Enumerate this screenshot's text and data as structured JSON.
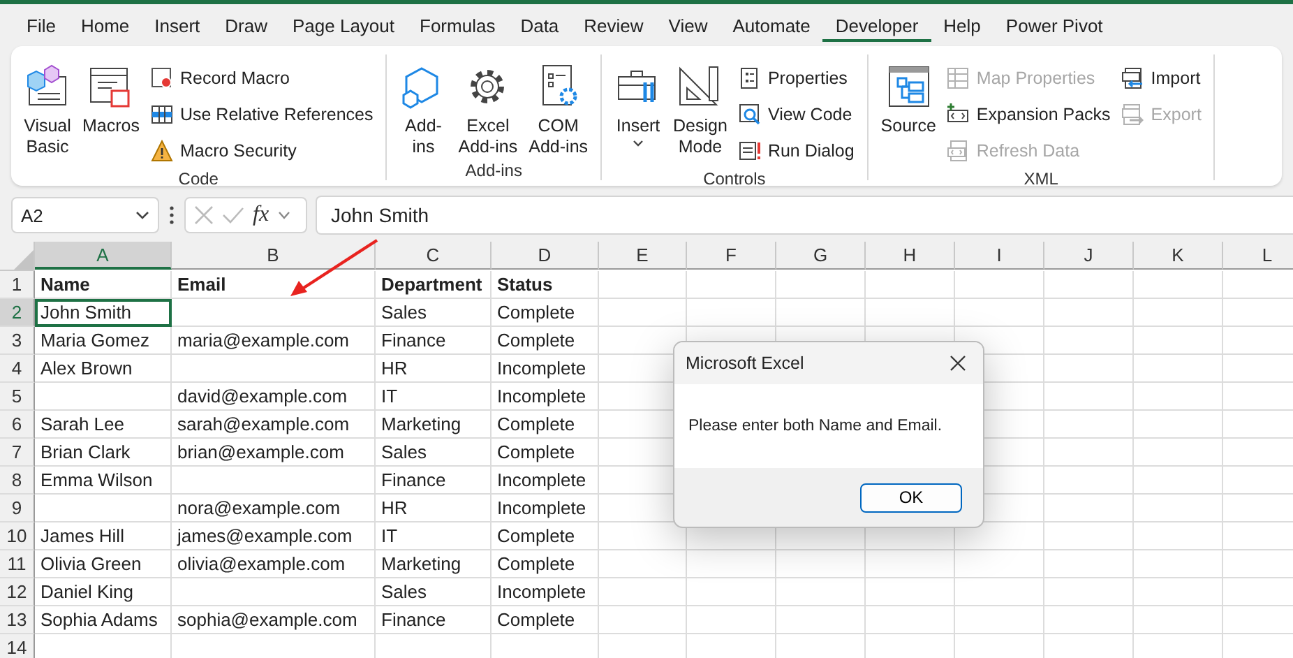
{
  "menu_tabs": [
    {
      "label": "File",
      "selected": false
    },
    {
      "label": "Home",
      "selected": false
    },
    {
      "label": "Insert",
      "selected": false
    },
    {
      "label": "Draw",
      "selected": false
    },
    {
      "label": "Page Layout",
      "selected": false
    },
    {
      "label": "Formulas",
      "selected": false
    },
    {
      "label": "Data",
      "selected": false
    },
    {
      "label": "Review",
      "selected": false
    },
    {
      "label": "View",
      "selected": false
    },
    {
      "label": "Automate",
      "selected": false
    },
    {
      "label": "Developer",
      "selected": true
    },
    {
      "label": "Help",
      "selected": false
    },
    {
      "label": "Power Pivot",
      "selected": false
    }
  ],
  "ribbon": {
    "groups": [
      {
        "label": "Code",
        "items": [
          {
            "kind": "large",
            "lines": [
              "Visual",
              "Basic"
            ]
          },
          {
            "kind": "large",
            "lines": [
              "Macros"
            ]
          },
          {
            "kind": "column",
            "items": [
              {
                "label": "Record Macro",
                "disabled": false
              },
              {
                "label": "Use Relative References",
                "disabled": false
              },
              {
                "label": "Macro Security",
                "disabled": false
              }
            ]
          }
        ]
      },
      {
        "label": "Add-ins",
        "items": [
          {
            "kind": "large",
            "lines": [
              "Add-",
              "ins"
            ]
          },
          {
            "kind": "large",
            "lines": [
              "Excel",
              "Add-ins"
            ]
          },
          {
            "kind": "large",
            "lines": [
              "COM",
              "Add-ins"
            ]
          }
        ]
      },
      {
        "label": "Controls",
        "items": [
          {
            "kind": "large",
            "lines": [
              "Insert"
            ],
            "has_menu": true
          },
          {
            "kind": "large",
            "lines": [
              "Design",
              "Mode"
            ]
          },
          {
            "kind": "column",
            "items": [
              {
                "label": "Properties",
                "disabled": false
              },
              {
                "label": "View Code",
                "disabled": false
              },
              {
                "label": "Run Dialog",
                "disabled": false
              }
            ]
          }
        ]
      },
      {
        "label": "XML",
        "items": [
          {
            "kind": "large",
            "lines": [
              "Source"
            ]
          },
          {
            "kind": "column",
            "items": [
              {
                "label": "Map Properties",
                "disabled": true
              },
              {
                "label": "Expansion Packs",
                "disabled": false
              },
              {
                "label": "Refresh Data",
                "disabled": true
              }
            ]
          },
          {
            "kind": "column",
            "items": [
              {
                "label": "Import",
                "disabled": false
              },
              {
                "label": "Export",
                "disabled": true
              }
            ]
          }
        ]
      }
    ]
  },
  "formula_bar": {
    "name_box": "A2",
    "function_label": "fx",
    "value": "John Smith"
  },
  "sheet": {
    "columns": [
      {
        "label": "A",
        "selected": true
      },
      {
        "label": "B",
        "selected": false
      },
      {
        "label": "C",
        "selected": false
      },
      {
        "label": "D",
        "selected": false
      },
      {
        "label": "E",
        "selected": false
      },
      {
        "label": "F",
        "selected": false
      },
      {
        "label": "G",
        "selected": false
      },
      {
        "label": "H",
        "selected": false
      },
      {
        "label": "I",
        "selected": false
      },
      {
        "label": "J",
        "selected": false
      },
      {
        "label": "K",
        "selected": false
      },
      {
        "label": "L",
        "selected": false
      }
    ],
    "rows": [
      {
        "number": "1",
        "kind": "header",
        "selected": false,
        "cells": {
          "A": {
            "text": "Name",
            "selected": false
          },
          "B": {
            "text": "Email",
            "selected": false
          },
          "C": {
            "text": "Department",
            "selected": false
          },
          "D": {
            "text": "Status",
            "selected": false
          }
        }
      },
      {
        "number": "2",
        "kind": "data",
        "selected": true,
        "cells": {
          "A": {
            "text": "John Smith",
            "selected": true
          },
          "C": {
            "text": "Sales",
            "selected": false
          },
          "D": {
            "text": "Complete",
            "selected": false
          }
        }
      },
      {
        "number": "3",
        "kind": "data",
        "selected": false,
        "cells": {
          "A": {
            "text": "Maria Gomez",
            "selected": false
          },
          "B": {
            "text": "maria@example.com",
            "selected": false
          },
          "C": {
            "text": "Finance",
            "selected": false
          },
          "D": {
            "text": "Complete",
            "selected": false
          }
        }
      },
      {
        "number": "4",
        "kind": "data",
        "selected": false,
        "cells": {
          "A": {
            "text": "Alex Brown",
            "selected": false
          },
          "C": {
            "text": "HR",
            "selected": false
          },
          "D": {
            "text": "Incomplete",
            "selected": false
          }
        }
      },
      {
        "number": "5",
        "kind": "data",
        "selected": false,
        "cells": {
          "B": {
            "text": "david@example.com",
            "selected": false
          },
          "C": {
            "text": "IT",
            "selected": false
          },
          "D": {
            "text": "Incomplete",
            "selected": false
          }
        }
      },
      {
        "number": "6",
        "kind": "data",
        "selected": false,
        "cells": {
          "A": {
            "text": "Sarah Lee",
            "selected": false
          },
          "B": {
            "text": "sarah@example.com",
            "selected": false
          },
          "C": {
            "text": "Marketing",
            "selected": false
          },
          "D": {
            "text": "Complete",
            "selected": false
          }
        }
      },
      {
        "number": "7",
        "kind": "data",
        "selected": false,
        "cells": {
          "A": {
            "text": "Brian Clark",
            "selected": false
          },
          "B": {
            "text": "brian@example.com",
            "selected": false
          },
          "C": {
            "text": "Sales",
            "selected": false
          },
          "D": {
            "text": "Complete",
            "selected": false
          }
        }
      },
      {
        "number": "8",
        "kind": "data",
        "selected": false,
        "cells": {
          "A": {
            "text": "Emma Wilson",
            "selected": false
          },
          "C": {
            "text": "Finance",
            "selected": false
          },
          "D": {
            "text": "Incomplete",
            "selected": false
          }
        }
      },
      {
        "number": "9",
        "kind": "data",
        "selected": false,
        "cells": {
          "B": {
            "text": "nora@example.com",
            "selected": false
          },
          "C": {
            "text": "HR",
            "selected": false
          },
          "D": {
            "text": "Incomplete",
            "selected": false
          }
        }
      },
      {
        "number": "10",
        "kind": "data",
        "selected": false,
        "cells": {
          "A": {
            "text": "James Hill",
            "selected": false
          },
          "B": {
            "text": "james@example.com",
            "selected": false
          },
          "C": {
            "text": "IT",
            "selected": false
          },
          "D": {
            "text": "Complete",
            "selected": false
          }
        }
      },
      {
        "number": "11",
        "kind": "data",
        "selected": false,
        "cells": {
          "A": {
            "text": "Olivia Green",
            "selected": false
          },
          "B": {
            "text": "olivia@example.com",
            "selected": false
          },
          "C": {
            "text": "Marketing",
            "selected": false
          },
          "D": {
            "text": "Complete",
            "selected": false
          }
        }
      },
      {
        "number": "12",
        "kind": "data",
        "selected": false,
        "cells": {
          "A": {
            "text": "Daniel King",
            "selected": false
          },
          "C": {
            "text": "Sales",
            "selected": false
          },
          "D": {
            "text": "Incomplete",
            "selected": false
          }
        }
      },
      {
        "number": "13",
        "kind": "data",
        "selected": false,
        "cells": {
          "A": {
            "text": "Sophia Adams",
            "selected": false
          },
          "B": {
            "text": "sophia@example.com",
            "selected": false
          },
          "C": {
            "text": "Finance",
            "selected": false
          },
          "D": {
            "text": "Complete",
            "selected": false
          }
        }
      },
      {
        "number": "14",
        "selected": false
      }
    ]
  },
  "dialog": {
    "title": "Microsoft Excel",
    "message": "Please enter both Name and Email.",
    "button": "OK"
  }
}
